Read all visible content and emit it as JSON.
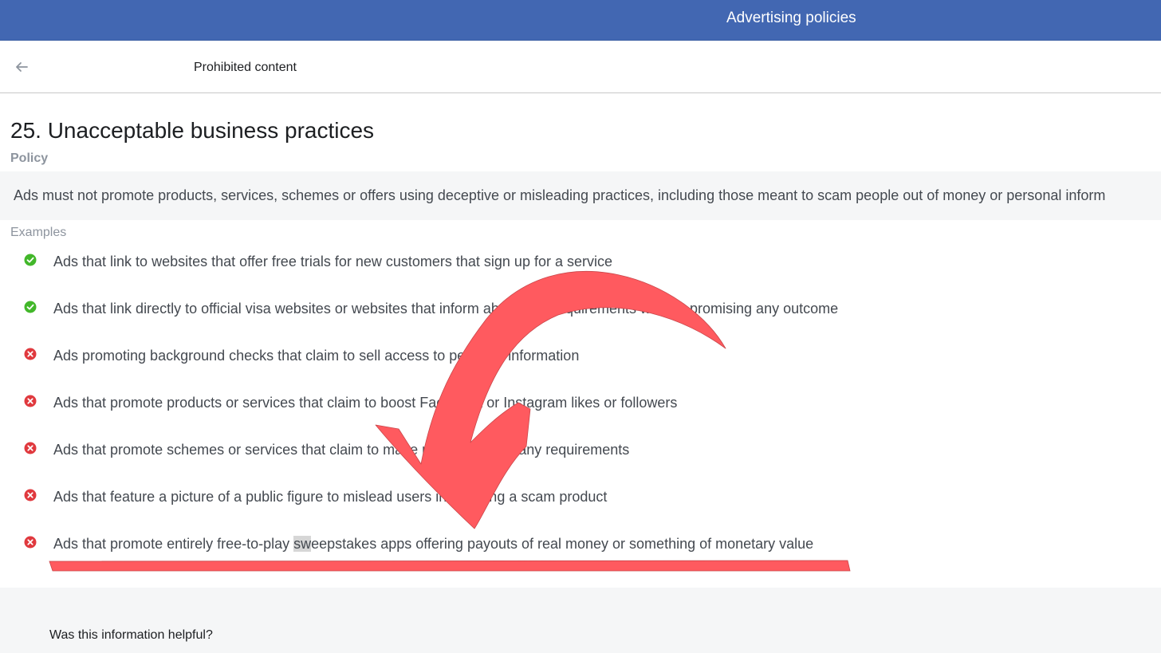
{
  "header": {
    "title": "Advertising policies"
  },
  "subnav": {
    "back_icon": "arrow-left-icon",
    "title": "Prohibited content"
  },
  "page": {
    "title": "25. Unacceptable business practices",
    "policy_label": "Policy",
    "policy_text": "Ads must not promote products, services, schemes or offers using deceptive or misleading practices, including those meant to scam people out of money or personal inform",
    "examples_label": "Examples"
  },
  "examples": [
    {
      "status": "allowed",
      "icon": "check-circle-icon",
      "text": "Ads that link to websites that offer free trials for new customers that sign up for a service"
    },
    {
      "status": "allowed",
      "icon": "check-circle-icon",
      "text": "Ads that link directly to official visa websites or websites that inform about visa requirements without promising any outcome"
    },
    {
      "status": "prohibited",
      "icon": "x-circle-icon",
      "text": "Ads promoting background checks that claim to sell access to personal information"
    },
    {
      "status": "prohibited",
      "icon": "x-circle-icon",
      "text": "Ads that promote products or services that claim to boost Facebook or Instagram likes or followers"
    },
    {
      "status": "prohibited",
      "icon": "x-circle-icon",
      "text": "Ads that promote schemes or services that claim to make money without any requirements"
    },
    {
      "status": "prohibited",
      "icon": "x-circle-icon",
      "text": "Ads that feature a picture of a public figure to mislead users into buying a scam product"
    },
    {
      "status": "prohibited",
      "icon": "x-circle-icon",
      "text_before": "Ads that promote entirely free-to-play ",
      "text_highlight": "sw",
      "text_after": "eepstakes apps offering payouts of real money or something of monetary value"
    }
  ],
  "footer": {
    "question": "Was this information helpful?"
  },
  "colors": {
    "header_blue": "#4267b2",
    "allowed_green": "#42b72a",
    "prohibited_red": "#e0393e",
    "annotation_red": "#ff5a5f"
  }
}
